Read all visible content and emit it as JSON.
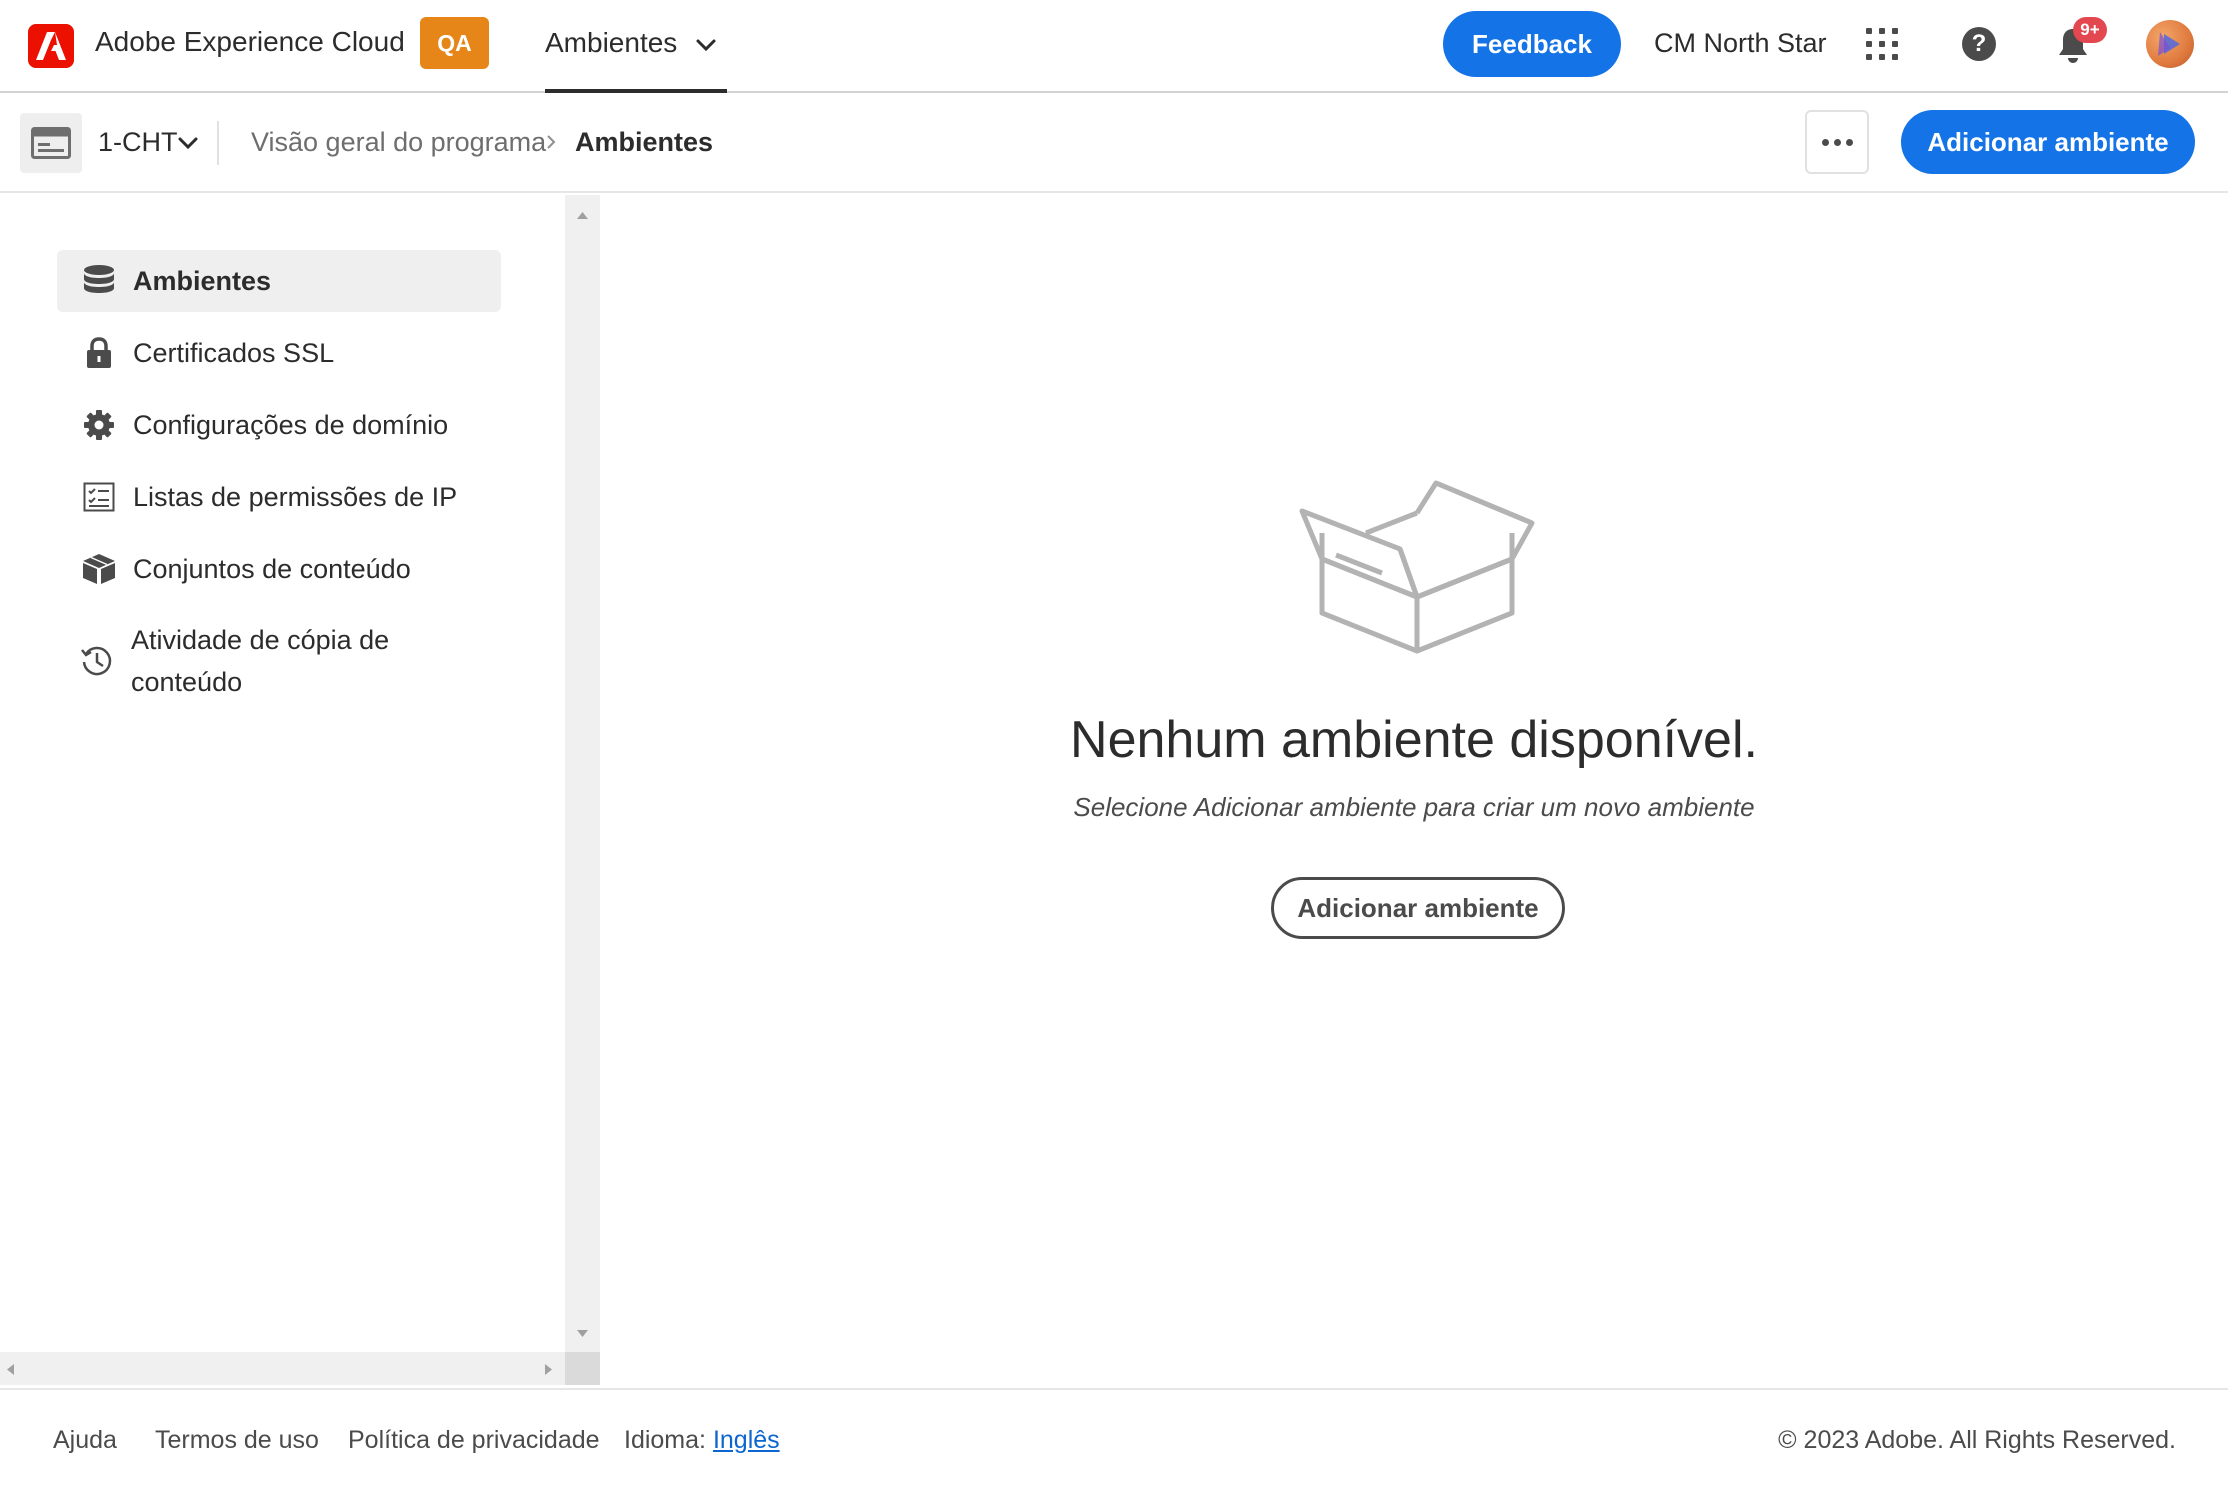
{
  "header": {
    "app_title": "Adobe Experience Cloud",
    "env_badge": "QA",
    "nav_menu_label": "Ambientes",
    "feedback_label": "Feedback",
    "org_name": "CM North Star",
    "notification_count": "9+",
    "icons": {
      "logo": "adobe-logo-icon",
      "apps": "app-switcher-icon",
      "help": "help-icon",
      "notifications": "bell-icon",
      "avatar": "user-avatar"
    }
  },
  "subheader": {
    "program_name": "1-CHT",
    "breadcrumbs": [
      "Visão geral do programa",
      "Ambientes"
    ],
    "add_environment_label": "Adicionar ambiente"
  },
  "sidebar": {
    "items": [
      {
        "label": "Ambientes",
        "icon": "database-icon",
        "active": true
      },
      {
        "label": "Certificados SSL",
        "icon": "lock-icon",
        "active": false
      },
      {
        "label": "Configurações de domínio",
        "icon": "gear-icon",
        "active": false
      },
      {
        "label": "Listas de permissões de IP",
        "icon": "checklist-icon",
        "active": false
      },
      {
        "label": "Conjuntos de conteúdo",
        "icon": "boxes-icon",
        "active": false
      },
      {
        "label": "Atividade de cópia de conteúdo",
        "icon": "history-icon",
        "active": false
      }
    ]
  },
  "main": {
    "empty_title": "Nenhum ambiente disponível.",
    "empty_subtitle": "Selecione Adicionar ambiente para criar um novo ambiente",
    "add_environment_label": "Adicionar ambiente",
    "illustration": "empty-box-icon"
  },
  "footer": {
    "help": "Ajuda",
    "terms": "Termos de uso",
    "privacy": "Política de privacidade",
    "language_label": "Idioma:",
    "language_value": "Inglês",
    "copyright": "© 2023 Adobe. All Rights Reserved."
  },
  "colors": {
    "accent": "#1473e6",
    "adobe_red": "#eb1000",
    "qa_badge": "#e68619",
    "notification_badge": "#e34850"
  }
}
